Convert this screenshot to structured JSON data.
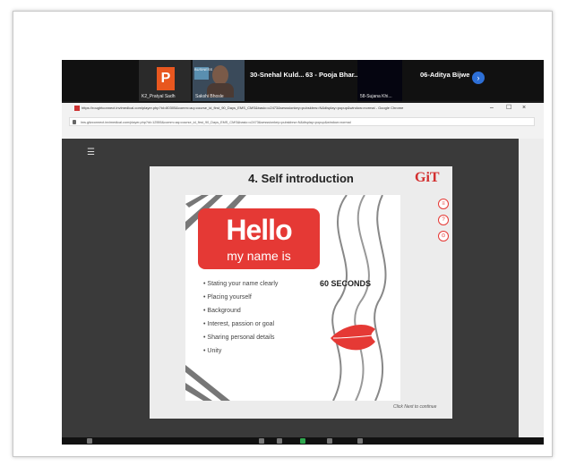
{
  "participants": {
    "tile1_letter": "P",
    "tile1_name": "K2_Pratyal Sadh",
    "tile2_name": "Sakshi Bhosle",
    "tile2_badge": "BUSINESS",
    "name3": "30-Snehal  Kuld...",
    "name4": "63 - Pooja Bhar...",
    "tile5_name": "58-Sujana Khi...",
    "name6": "06-Aditya Bijwe",
    "next_icon": "chevron-right-icon"
  },
  "browser": {
    "title": "https://roughtconnect.invimedical.com/player.php?id=80305&comm=aq=course_id_first_90_Days_EMS_CMS&basic=c2473&sesssionkey=pubskbrw=N&display=popup&window=normal - Google Chrome",
    "url": "lms.gitzconnect.invimedical.com/player.php?id=12555&comm=aq=course_id_first_90_Days_EMS_CMS&basic=c2473&sesssionkey=pubskbrw=N&display=popup&window=normal",
    "minimize": "–",
    "maximize": "☐",
    "close": "×"
  },
  "slide": {
    "title": "4. Self introduction",
    "logo": "GiT",
    "hello": "Hello",
    "my_name_is": "my name is",
    "bullets": [
      "• Stating your name clearly",
      "• Placing yourself",
      "• Background",
      "• Interest, passion or goal",
      "• Sharing personal details",
      "• Unity"
    ],
    "seconds": "60 SECONDS",
    "click_next": "Click Next to continue",
    "side_icons": [
      "≡",
      "?",
      "⊙"
    ]
  },
  "colors": {
    "accent_red": "#e53935",
    "zoom_blue": "#2d6fd6",
    "p_orange": "#e8571f"
  }
}
